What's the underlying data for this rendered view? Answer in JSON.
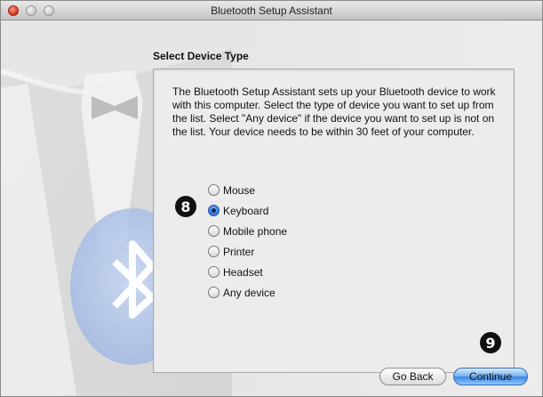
{
  "window": {
    "title": "Bluetooth Setup Assistant"
  },
  "section": {
    "title": "Select Device Type"
  },
  "description": "The Bluetooth Setup Assistant sets up your Bluetooth device to work with this computer. Select the type of device you want to set up from the list. Select \"Any device\" if the device you want to set up is not on the list. Your device needs to be within 30 feet of your computer.",
  "device_types": [
    {
      "label": "Mouse",
      "selected": false
    },
    {
      "label": "Keyboard",
      "selected": true
    },
    {
      "label": "Mobile phone",
      "selected": false
    },
    {
      "label": "Printer",
      "selected": false
    },
    {
      "label": "Headset",
      "selected": false
    },
    {
      "label": "Any device",
      "selected": false
    }
  ],
  "callouts": {
    "radio": "8",
    "continue": "9"
  },
  "buttons": {
    "back": "Go Back",
    "continue": "Continue"
  }
}
